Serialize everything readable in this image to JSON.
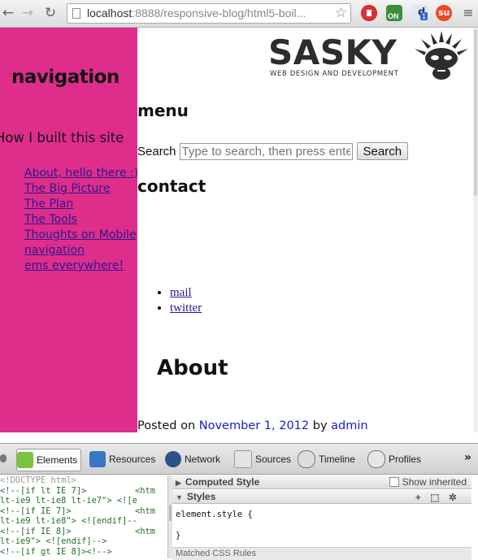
{
  "browser": {
    "url_host": "localhost",
    "url_rest": ":8888/responsive-blog/html5-boil...",
    "back_icon": "back-arrow-icon",
    "forward_icon": "forward-arrow-icon",
    "reload_icon": "reload-icon",
    "extension_badge_on": "ON",
    "extension_badge_count": "1"
  },
  "sidebar": {
    "title": "navigation",
    "subtitle": "How I built this site",
    "links": [
      "About, hello there :)",
      "The Big Picture",
      "The Plan",
      "The Tools",
      "Thoughts on Mobile",
      "navigation",
      "ems everywhere!"
    ]
  },
  "main": {
    "logo_name": "SASKY",
    "logo_tagline": "WEB DESIGN AND DEVELOPMENT",
    "menu_heading": "menu",
    "search_label": "Search",
    "search_placeholder": "Type to search, then press enter",
    "search_button": "Search",
    "contact_heading": "contact",
    "contact_links": [
      "mail",
      "twitter"
    ],
    "about_heading": "About",
    "posted_prefix": "Posted on",
    "posted_date": "November 1, 2012",
    "posted_by": "by",
    "posted_author": "admin"
  },
  "devtools": {
    "tabs": [
      "Elements",
      "Resources",
      "Network",
      "Sources",
      "Timeline",
      "Profiles"
    ],
    "more": "»",
    "code_lines": [
      {
        "left": "<!DOCTYPE html>",
        "right": ""
      },
      {
        "left": "<!--[if lt IE 7]>",
        "right": "<htm"
      },
      {
        "left": "lt-ie9 lt-ie8 lt-ie7\"> <![e",
        "right": ""
      },
      {
        "left": "<!--[if IE 7]>",
        "right": "<htm"
      },
      {
        "left": "lt-ie9 lt-ie8\"> <![endif]--",
        "right": ""
      },
      {
        "left": "<!--[if IE 8]>",
        "right": "<htm"
      },
      {
        "left": "lt-ie9\"> <![endif]-->",
        "right": ""
      },
      {
        "left": "<!--[if gt IE 8]><!-->",
        "right": ""
      }
    ],
    "computed_style": "Computed Style",
    "show_inherited": "Show inherited",
    "styles": "Styles",
    "styles_tools": "+ ⬚ ✲",
    "element_style_open": "element.style {",
    "element_style_close": "}",
    "matched_rules": "Matched CSS Rules"
  },
  "colors": {
    "sidebar_bg": "#df2d8c",
    "link": "#2a1a8c",
    "posted_link": "#1a1ad0"
  }
}
